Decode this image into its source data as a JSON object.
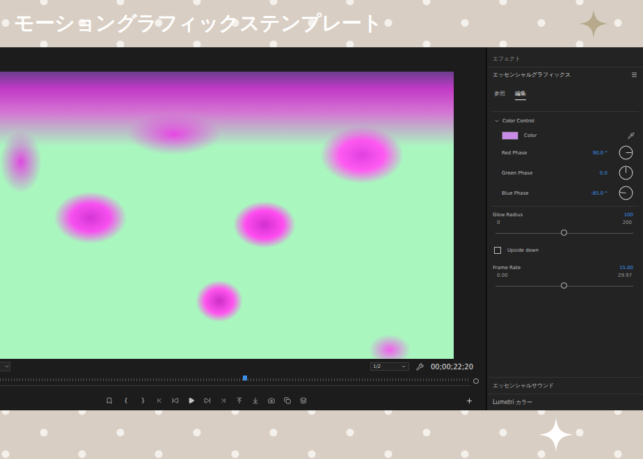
{
  "banner": {
    "title": "モーショングラフィックステンプレート"
  },
  "monitor": {
    "zoom": "1/2",
    "timecode": "00;00;22;20",
    "playhead": {
      "level": 0.52
    },
    "transport": {
      "mark_in": "{",
      "mark_out": "}"
    }
  },
  "panel": {
    "header": "エフェクト",
    "title": "エッセンシャルグラフィックス",
    "tabs": [
      {
        "label": "参照",
        "selected": false
      },
      {
        "label": "編集",
        "selected": true
      }
    ],
    "section": {
      "title": "Color Control",
      "expanded": true
    },
    "color": {
      "label": "Color",
      "swatch": "#c98be8"
    },
    "phases": [
      {
        "label": "Red Phase",
        "reading": "90.0 °",
        "angle": 90
      },
      {
        "label": "Green Phase",
        "reading": "0.0",
        "angle": 0
      },
      {
        "label": "Blue Phase",
        "reading": "-85.0 °",
        "angle": -85
      }
    ],
    "glow_radius": {
      "label": "Glow Radius",
      "reading": "100",
      "min": "0",
      "max": "200",
      "level": 0.5
    },
    "upside_down": {
      "label": "Upside down",
      "checked": false
    },
    "frame_rate": {
      "label": "Frame Rate",
      "reading": "15.00",
      "min": "0.00",
      "max": "29.97",
      "level": 0.5
    },
    "footer_sections": [
      "エッセンシャルサウンド",
      "Lumetri カラー"
    ]
  }
}
